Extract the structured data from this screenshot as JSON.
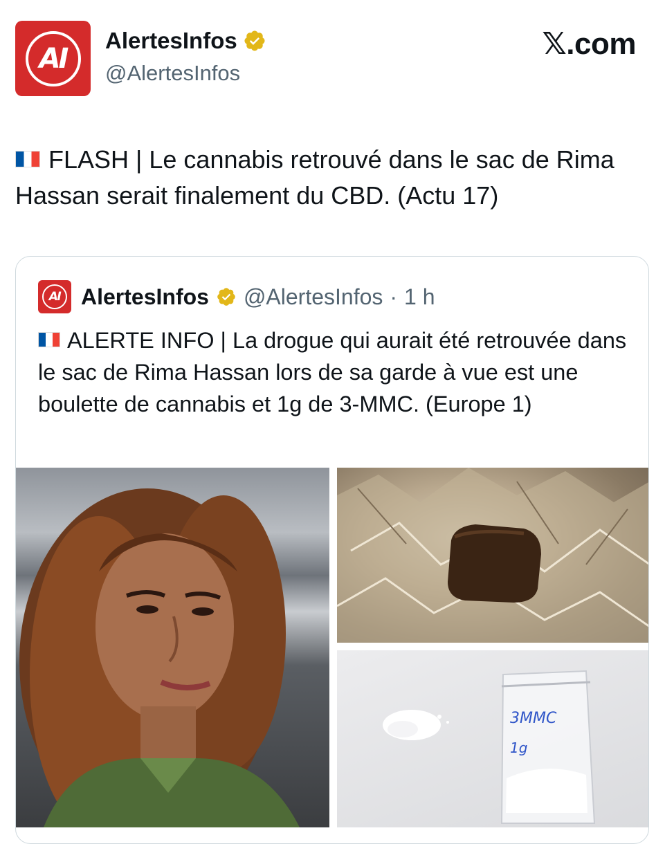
{
  "post": {
    "author_name": "AlertesInfos",
    "author_handle": "@AlertesInfos",
    "logo_text": "AI",
    "brand": "𝕏.com",
    "flag": "🇫🇷",
    "text": "FLASH | Le cannabis retrouvé dans le sac de Rima Hassan serait finalement du CBD. (Actu 17)"
  },
  "quote": {
    "author_name": "AlertesInfos",
    "author_handle": "@AlertesInfos",
    "separator": "·",
    "time": "1 h",
    "logo_text": "AI",
    "flag": "🇫🇷",
    "text": "ALERTE INFO | La drogue qui aurait été retrouvée dans le sac de Rima Hassan lors de sa garde à vue est une boulette de cannabis et 1g de 3-MMC. (Europe 1)",
    "bag_label_1": "3MMC",
    "bag_label_2": "1g"
  },
  "colors": {
    "logo_red": "#d42b2b",
    "verified_gold": "#e2b719",
    "text_primary": "#0f1419",
    "text_secondary": "#536471",
    "border": "#cfd9de"
  },
  "icons": [
    "verified-badge-icon",
    "france-flag-icon"
  ]
}
